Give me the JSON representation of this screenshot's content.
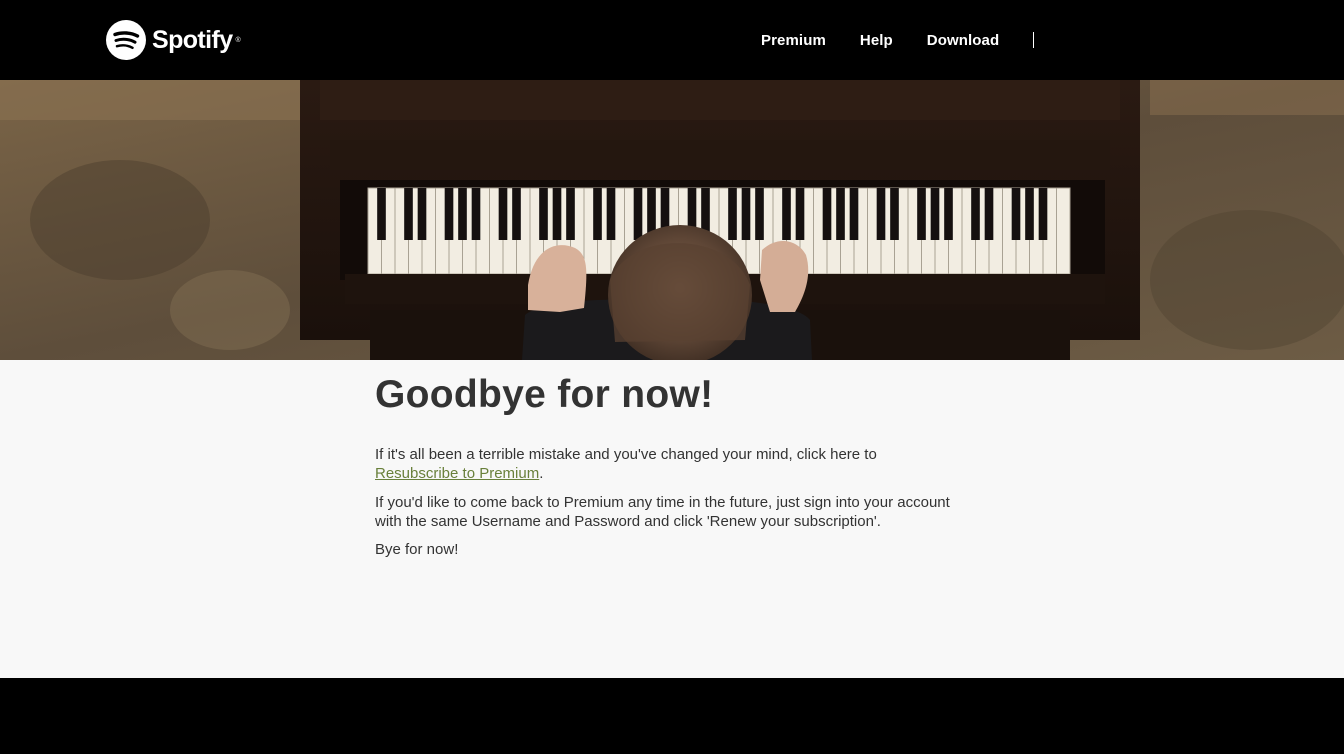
{
  "header": {
    "brand": "Spotify",
    "brand_mark": "spotify-logo-icon",
    "nav": [
      {
        "label": "Premium"
      },
      {
        "label": "Help"
      },
      {
        "label": "Download"
      }
    ]
  },
  "hero": {
    "image": "person-playing-upright-piano-photo"
  },
  "main": {
    "title": "Goodbye for now!",
    "para1_before": "If it's all been a terrible mistake and you've changed your mind, click here to",
    "resubscribe_link": "Resubscribe to Premium",
    "para1_after": ".",
    "para2": "If you'd like to come back to Premium any time in the future, just sign into your account with the same Username and Password and click 'Renew your subscription'.",
    "para3": "Bye for now!"
  },
  "colors": {
    "header_bg": "#000000",
    "content_bg": "#f8f8f8",
    "text": "#333333",
    "link": "#69803b"
  }
}
